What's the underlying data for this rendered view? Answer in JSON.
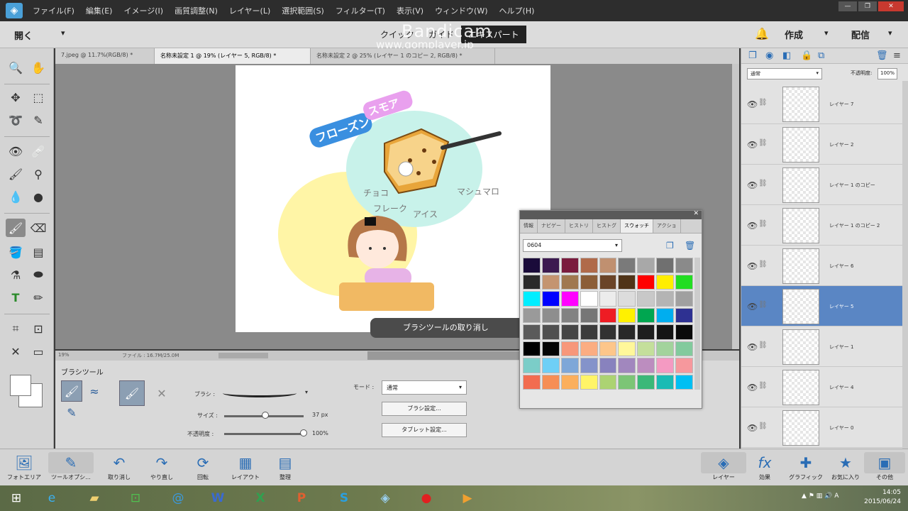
{
  "menubar": {
    "items": [
      "ファイル(F)",
      "編集(E)",
      "イメージ(I)",
      "画質調整(N)",
      "レイヤー(L)",
      "選択範囲(S)",
      "フィルター(T)",
      "表示(V)",
      "ウィンドウ(W)",
      "ヘルプ(H)"
    ]
  },
  "topbar": {
    "open": "開く",
    "modes": [
      "クイック",
      "ガイド",
      "エキスパート"
    ],
    "watermark": "Bandicam",
    "watermark_url": "www.gomplayer.jp",
    "create": "作成",
    "share": "配信"
  },
  "tabs": [
    "7.jpeg @ 11.7%(RGB/8) *",
    "名称未設定 1 @ 19% (レイヤー 5, RGB/8) *",
    "名称未設定 2 @ 25% (レイヤー 1 のコピー 2, RGB/8) *"
  ],
  "statusbar": {
    "zoom": "19%",
    "fileinfo": "ファイル : 16.7M/25.0M"
  },
  "toast": "ブラシツールの取り消し",
  "options": {
    "title": "ブラシツール",
    "brush_label": "ブラシ :",
    "size_label": "サイズ :",
    "size_value": "37 px",
    "size_level": 0.52,
    "opacity_label": "不透明度 :",
    "opacity_value": "100%",
    "opacity_level": 1.0,
    "mode_label": "モード :",
    "mode_value": "通常",
    "brush_settings": "ブラシ設定...",
    "tablet_settings": "タブレット設定..."
  },
  "swatches": {
    "tabs": [
      "情報",
      "ナビゲー",
      "ヒストリ",
      "ヒストグ",
      "スウォッチ",
      "アクショ"
    ],
    "active_tab": "スウォッチ",
    "preset": "0604",
    "colors": [
      "#1a0b3a",
      "#3c1a50",
      "#7a1c3e",
      "#b06a4a",
      "#c09070",
      "#7a7a7a",
      "#a8a8a8",
      "#707070",
      "#8a8a8a",
      "#2a2a2a",
      "#c49470",
      "#a07850",
      "#8c5e38",
      "#6a4428",
      "#503418",
      "#ff0000",
      "#ffee00",
      "#22dd22",
      "#00eeff",
      "#0000ff",
      "#ff00ff",
      "#ffffff",
      "#ececec",
      "#dcdcdc",
      "#c8c8c8",
      "#b4b4b4",
      "#a0a0a0",
      "#9a9a9a",
      "#8e8e8e",
      "#828282",
      "#767676",
      "#ee1c24",
      "#fff100",
      "#00a650",
      "#00aeef",
      "#2e3192",
      "#5a5a5a",
      "#505050",
      "#464646",
      "#3c3c3c",
      "#323232",
      "#282828",
      "#1e1e1e",
      "#141414",
      "#0a0a0a",
      "#000000",
      "#050505",
      "#f7977a",
      "#fbad82",
      "#fdc68a",
      "#fff79a",
      "#c4df9b",
      "#a2d39c",
      "#82ca9d",
      "#7bcdc8",
      "#6ecff6",
      "#7ea7d8",
      "#8493ca",
      "#8882be",
      "#a187be",
      "#bc8dbf",
      "#f49ac2",
      "#f6989d",
      "#f26c4f",
      "#f68e55",
      "#fbaf5c",
      "#fff467",
      "#acd372",
      "#7cc576",
      "#3bb878",
      "#1abbb4",
      "#00bff3"
    ]
  },
  "layers": {
    "blend_mode": "通常",
    "opacity_label": "不透明度:",
    "opacity_value": "100%",
    "items": [
      {
        "name": "レイヤー 7",
        "selected": false
      },
      {
        "name": "レイヤー 2",
        "selected": false
      },
      {
        "name": "レイヤー 1 のコピー",
        "selected": false
      },
      {
        "name": "レイヤー 1 のコピー 2",
        "selected": false
      },
      {
        "name": "レイヤー 6",
        "selected": false
      },
      {
        "name": "レイヤー 5",
        "selected": true
      },
      {
        "name": "レイヤー 1",
        "selected": false
      },
      {
        "name": "レイヤー 4",
        "selected": false
      },
      {
        "name": "レイヤー 0",
        "selected": false
      }
    ]
  },
  "bottombar": {
    "left": [
      "フォトエリア",
      "ツールオプシ...",
      "取り消し",
      "やり直し",
      "回転",
      "レイアウト",
      "整理"
    ],
    "right": [
      "レイヤー",
      "効果",
      "グラフィック",
      "お気に入り",
      "その他"
    ]
  },
  "taskbar": {
    "time": "14:05",
    "date": "2015/06/24",
    "ime": "A"
  },
  "artwork": {
    "title_part1": "フローズン",
    "title_part2": "スモア",
    "notes": [
      "チョコ",
      "フレーク",
      "アイス",
      "マシュマロ"
    ]
  }
}
